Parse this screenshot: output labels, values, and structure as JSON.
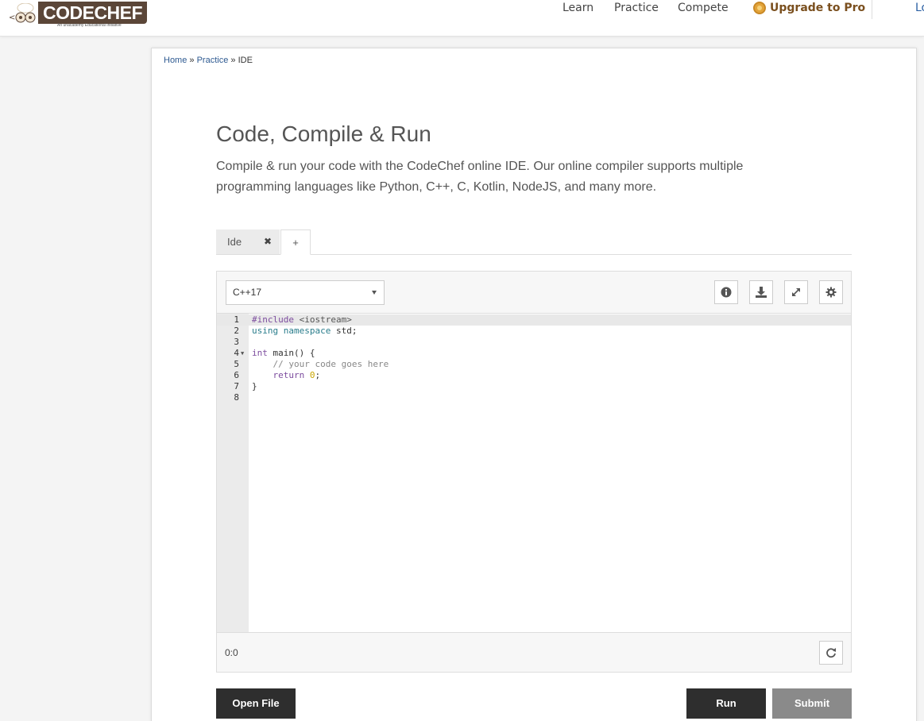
{
  "header": {
    "logo_text": "CODECHEF",
    "logo_sub": "An unacademy Educational Initiative",
    "nav": {
      "learn": "Learn",
      "practice": "Practice",
      "compete": "Compete",
      "upgrade": "Upgrade to Pro",
      "login": "Lo"
    }
  },
  "breadcrumb": {
    "home": "Home",
    "practice": "Practice",
    "current": "IDE",
    "separator": "»"
  },
  "page": {
    "title": "Code, Compile & Run",
    "description": "Compile & run your code with the CodeChef online IDE. Our online compiler supports multiple programming languages like Python, C++, C, Kotlin, NodeJS, and many more."
  },
  "tabs": {
    "ide_label": "Ide",
    "close_glyph": "✖",
    "add_glyph": "+"
  },
  "editor": {
    "language": "C++17",
    "line_numbers": [
      "1",
      "2",
      "3",
      "4",
      "5",
      "6",
      "7",
      "8"
    ],
    "cursor_position": "0:0"
  },
  "buttons": {
    "open_file": "Open File",
    "run": "Run",
    "submit": "Submit"
  },
  "icons": {
    "info": "info-icon",
    "download": "download-icon",
    "expand": "expand-icon",
    "settings": "gear-icon",
    "reset": "refresh-icon"
  },
  "colors": {
    "dark_button": "#2e2e2e",
    "submit_button": "#8a8a8a",
    "link": "#2e5a91",
    "pro_text": "#7a4f1e"
  }
}
